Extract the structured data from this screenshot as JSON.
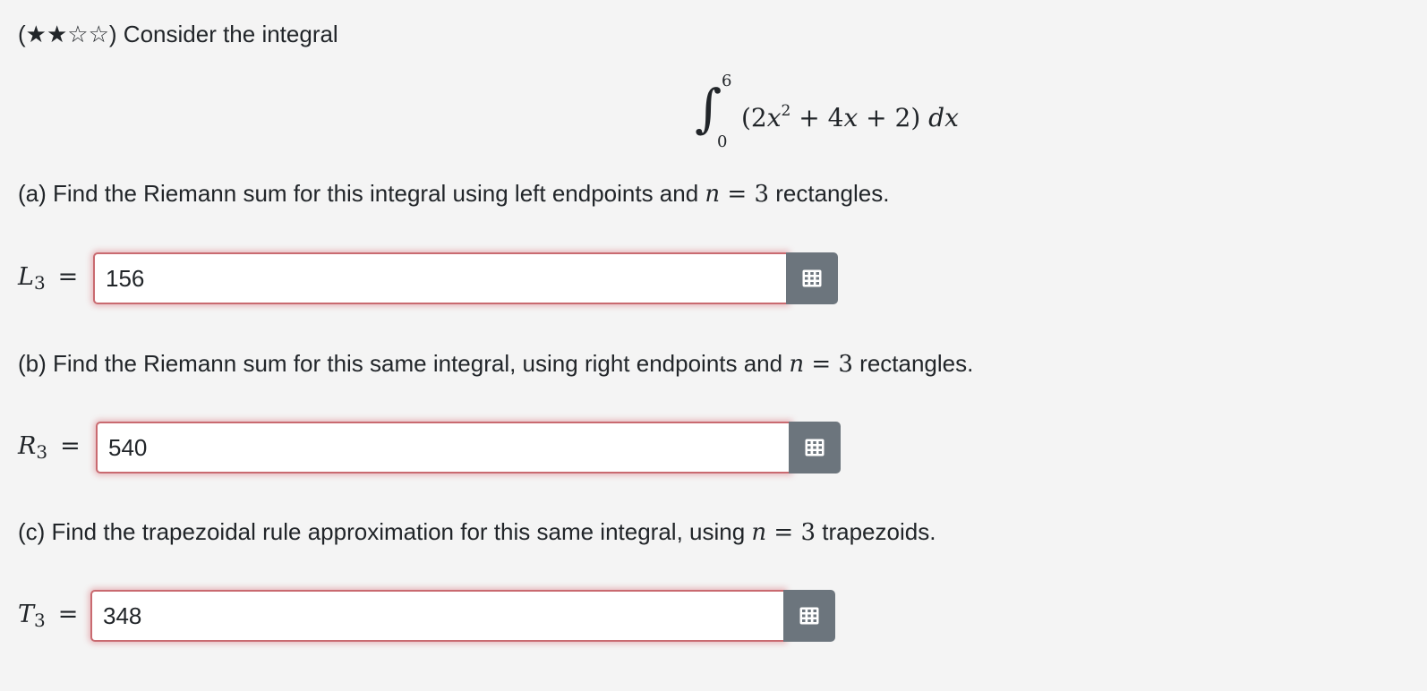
{
  "intro": {
    "difficulty": "(★★☆☆)",
    "text": "Consider the integral"
  },
  "integral": {
    "upper": "6",
    "lower": "0",
    "integrand_pre": "(2",
    "x1": "x",
    "exp": "2",
    "integrand_mid": " + 4",
    "x2": "x",
    "integrand_post": " + 2) ",
    "dx": "dx"
  },
  "parts": {
    "a": {
      "prefix": "(a) Find the Riemann sum for this integral using left endpoints and ",
      "n": "n",
      "eq": " = 3",
      "suffix": " rectangles.",
      "label_letter": "L",
      "label_sub": "3",
      "equals": "=",
      "value": "156"
    },
    "b": {
      "prefix": "(b) Find the Riemann sum for this same integral, using right endpoints and ",
      "n": "n",
      "eq": " = 3",
      "suffix": " rectangles.",
      "label_letter": "R",
      "label_sub": "3",
      "equals": "=",
      "value": "540"
    },
    "c": {
      "prefix": "(c) Find the trapezoidal rule approximation for this same integral, using ",
      "n": "n",
      "eq": " = 3",
      "suffix": " trapezoids.",
      "label_letter": "T",
      "label_sub": "3",
      "equals": "=",
      "value": "348"
    }
  },
  "icons": {
    "matrix_button_icon": "grid-icon"
  },
  "colors": {
    "input_border_error": "#c96a70",
    "button_bg": "#6c757d",
    "page_bg": "#f4f4f4"
  }
}
